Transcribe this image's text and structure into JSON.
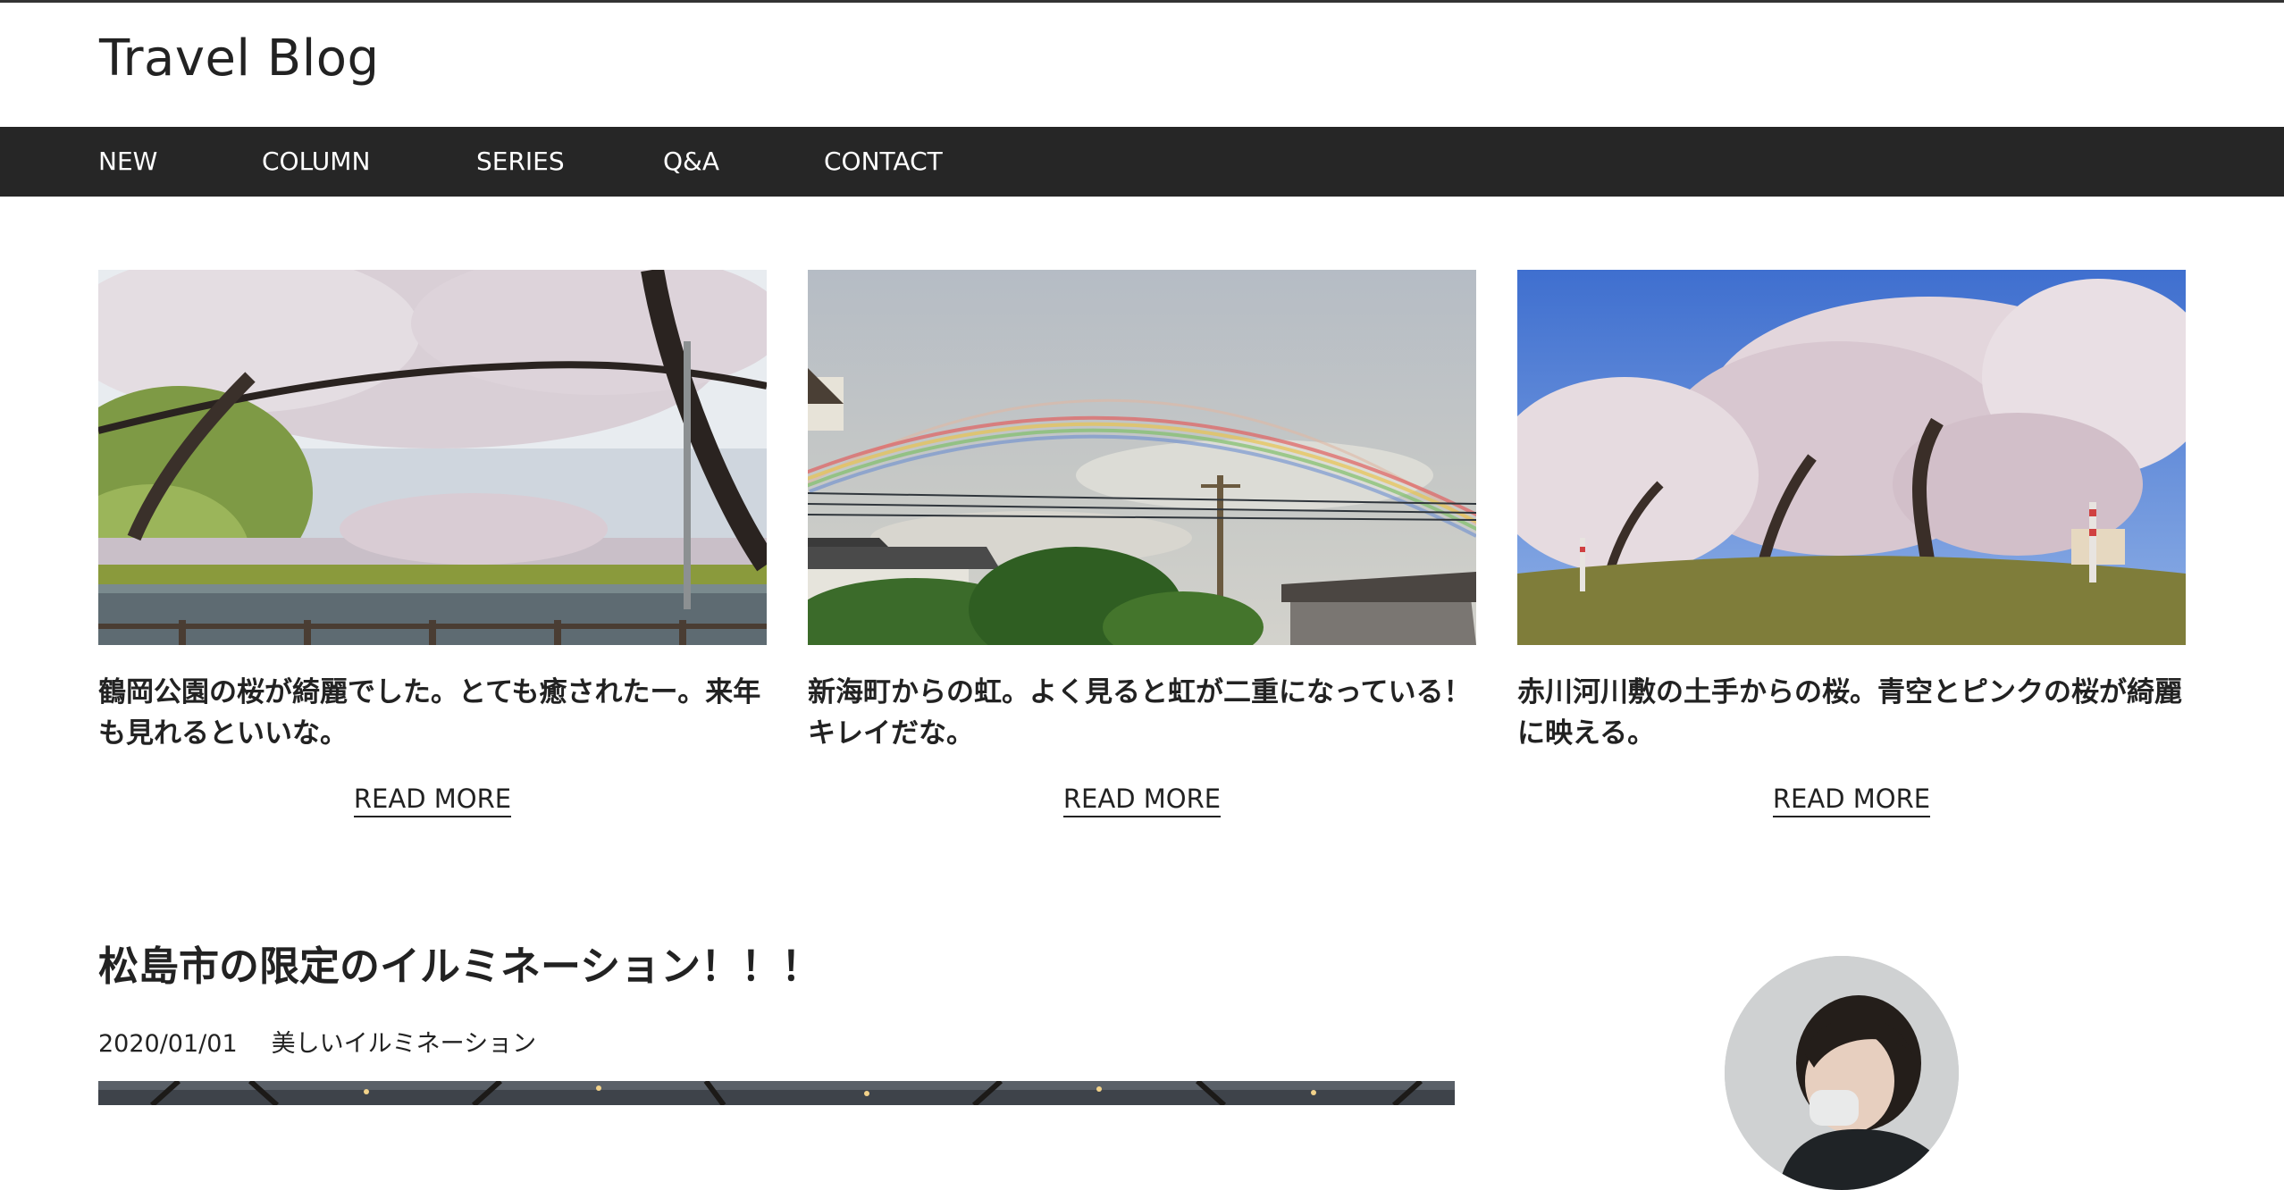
{
  "header": {
    "site_title": "Travel Blog"
  },
  "nav": {
    "items": [
      {
        "label": "NEW"
      },
      {
        "label": "COLUMN"
      },
      {
        "label": "SERIES"
      },
      {
        "label": "Q&A"
      },
      {
        "label": "CONTACT"
      }
    ]
  },
  "cards": [
    {
      "title": "鶴岡公園の桜が綺麗でした。とても癒されたー。来年も見れるといいな。",
      "read_more": "READ MORE",
      "image": "cherry-blossom-park-photo"
    },
    {
      "title": "新海町からの虹。よく見ると虹が二重になっている！キレイだな。",
      "read_more": "READ MORE",
      "image": "double-rainbow-photo"
    },
    {
      "title": "赤川河川敷の土手からの桜。青空とピンクの桜が綺麗に映える。",
      "read_more": "READ MORE",
      "image": "riverbank-cherry-trees-photo"
    }
  ],
  "featured_post": {
    "title": "松島市の限定のイルミネーション！！！",
    "date": "2020/01/01",
    "category": "美しいイルミネーション",
    "image": "illumination-photo"
  },
  "sidebar": {
    "avatar": "author-avatar-photo"
  },
  "colors": {
    "nav_background": "#262626",
    "nav_text": "#ffffff",
    "text": "#222222",
    "background": "#ffffff"
  }
}
